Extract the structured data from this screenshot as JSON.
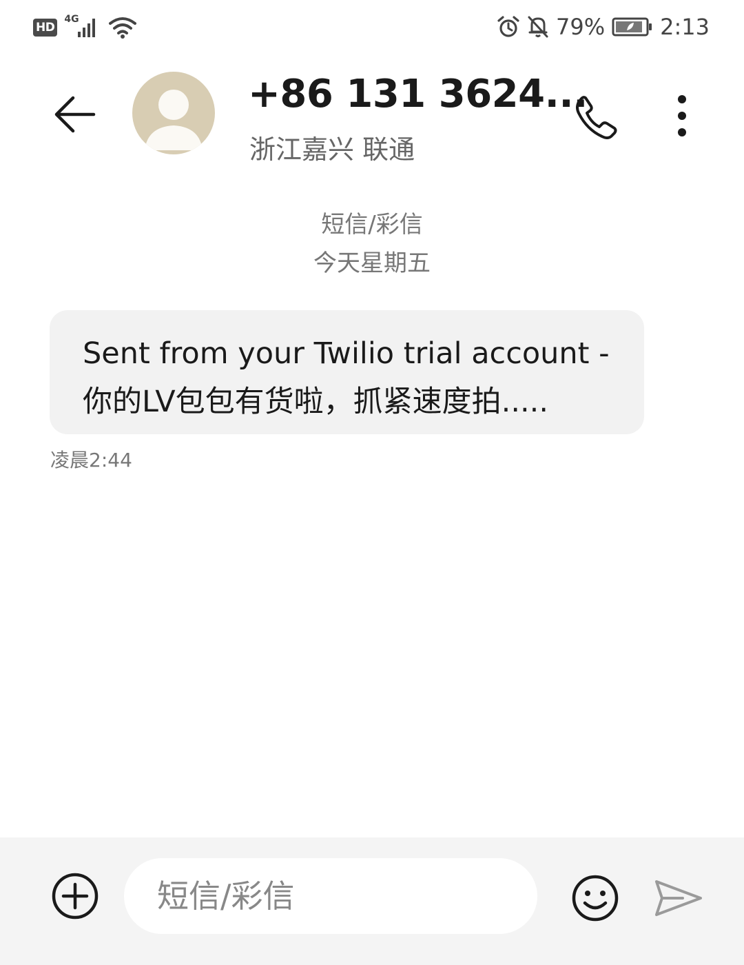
{
  "status_bar": {
    "hd": "HD",
    "network": "4G",
    "battery_percent": "79%",
    "time": "2:13",
    "icons": [
      "signal-icon",
      "wifi-icon",
      "alarm-icon",
      "mute-bell-icon",
      "battery-icon"
    ]
  },
  "header": {
    "contact_name": "+86 131 3624...",
    "contact_location": "浙江嘉兴 联通",
    "icons": [
      "back-arrow-icon",
      "avatar-person-icon",
      "phone-icon",
      "more-vertical-icon"
    ]
  },
  "thread": {
    "message_type": "短信/彩信",
    "date_label": "今天星期五",
    "messages": [
      {
        "line1": "Sent from your Twilio trial account -",
        "line2": "你的LV包包有货啦，抓紧速度拍.....",
        "time": "凌晨2:44"
      }
    ]
  },
  "input_bar": {
    "placeholder": "短信/彩信",
    "icons": [
      "add-circle-icon",
      "emoji-icon",
      "send-icon"
    ]
  },
  "colors": {
    "background": "#ffffff",
    "bubble": "#f2f2f2",
    "avatar": "#d8cdb3",
    "input_bar": "#f4f4f4",
    "secondary_text": "#777777"
  }
}
